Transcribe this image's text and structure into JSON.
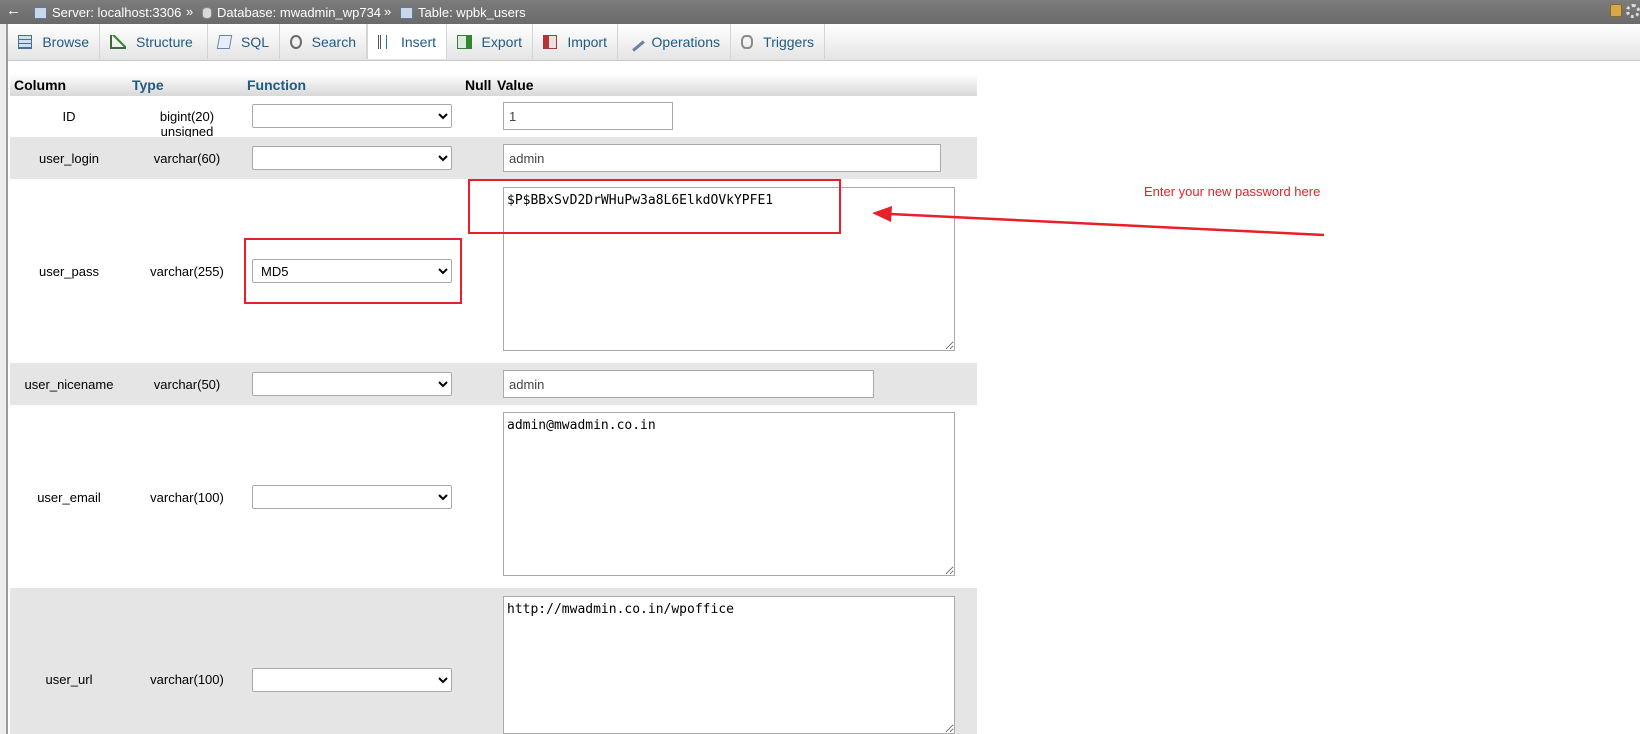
{
  "breadcrumb": {
    "server": "Server: localhost:3306",
    "database": "Database: mwadmin_wp734",
    "table": "Table: wpbk_users",
    "separator": "»"
  },
  "tabs": [
    {
      "label": "Browse",
      "icon": "browse-icon"
    },
    {
      "label": "Structure",
      "icon": "structure-icon"
    },
    {
      "label": "SQL",
      "icon": "sql-icon"
    },
    {
      "label": "Search",
      "icon": "search-icon"
    },
    {
      "label": "Insert",
      "icon": "insert-icon",
      "active": true
    },
    {
      "label": "Export",
      "icon": "export-icon"
    },
    {
      "label": "Import",
      "icon": "import-icon"
    },
    {
      "label": "Operations",
      "icon": "wrench-icon"
    },
    {
      "label": "Triggers",
      "icon": "triggers-icon"
    }
  ],
  "table_headers": {
    "column": "Column",
    "type": "Type",
    "function": "Function",
    "null": "Null",
    "value": "Value"
  },
  "rows": [
    {
      "column": "ID",
      "type": "bigint(20) unsigned",
      "function": "",
      "value": "1"
    },
    {
      "column": "user_login",
      "type": "varchar(60)",
      "function": "",
      "value": "admin"
    },
    {
      "column": "user_pass",
      "type": "varchar(255)",
      "function": "MD5",
      "value": "$P$BBxSvD2DrWHuPw3a8L6ElkdOVkYPFE1"
    },
    {
      "column": "user_nicename",
      "type": "varchar(50)",
      "function": "",
      "value": "admin"
    },
    {
      "column": "user_email",
      "type": "varchar(100)",
      "function": "",
      "value": "admin@mwadmin.co.in"
    },
    {
      "column": "user_url",
      "type": "varchar(100)",
      "function": "",
      "value": "http://mwadmin.co.in/wpoffice"
    }
  ],
  "annotation": {
    "text": "Enter your new password here",
    "color": "#e8202a"
  },
  "colors": {
    "tab_text": "#235a81",
    "breadcrumb_bg": "#727272",
    "row_alt": "#e5e5e5"
  }
}
